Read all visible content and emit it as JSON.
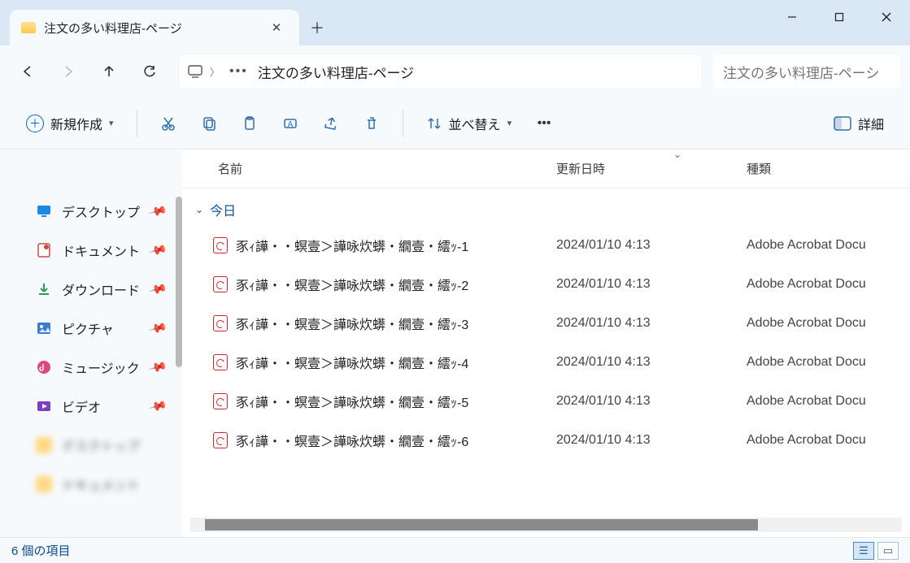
{
  "tab": {
    "title": "注文の多い料理店-ページ"
  },
  "address": {
    "segment": "注文の多い料理店-ページ"
  },
  "search": {
    "placeholder": "注文の多い料理店-ペーシ"
  },
  "toolbar": {
    "new_label": "新規作成",
    "sort_label": "並べ替え",
    "details_label": "詳細"
  },
  "sidebar": {
    "items": [
      {
        "label": "デスクトップ",
        "icon": "desktop",
        "color": "#1e88e5"
      },
      {
        "label": "ドキュメント",
        "icon": "document",
        "color": "#d04848"
      },
      {
        "label": "ダウンロード",
        "icon": "download",
        "color": "#2e9e55"
      },
      {
        "label": "ピクチャ",
        "icon": "picture",
        "color": "#3a7bd5"
      },
      {
        "label": "ミュージック",
        "icon": "music",
        "color": "#e0457b"
      },
      {
        "label": "ビデオ",
        "icon": "video",
        "color": "#7b3fbf"
      }
    ]
  },
  "columns": {
    "name": "名前",
    "date": "更新日時",
    "type": "種類"
  },
  "group": {
    "label": "今日"
  },
  "files": [
    {
      "name": "豕ｨ譁・・螟壹＞譁咏炊蠎・繝壹・繧ｯ-1",
      "date": "2024/01/10 4:13",
      "type": "Adobe Acrobat Docu"
    },
    {
      "name": "豕ｨ譁・・螟壹＞譁咏炊蠎・繝壹・繧ｯ-2",
      "date": "2024/01/10 4:13",
      "type": "Adobe Acrobat Docu"
    },
    {
      "name": "豕ｨ譁・・螟壹＞譁咏炊蠎・繝壹・繧ｯ-3",
      "date": "2024/01/10 4:13",
      "type": "Adobe Acrobat Docu"
    },
    {
      "name": "豕ｨ譁・・螟壹＞譁咏炊蠎・繝壹・繧ｯ-4",
      "date": "2024/01/10 4:13",
      "type": "Adobe Acrobat Docu"
    },
    {
      "name": "豕ｨ譁・・螟壹＞譁咏炊蠎・繝壹・繧ｯ-5",
      "date": "2024/01/10 4:13",
      "type": "Adobe Acrobat Docu"
    },
    {
      "name": "豕ｨ譁・・螟壹＞譁咏炊蠎・繝壹・繧ｯ-6",
      "date": "2024/01/10 4:13",
      "type": "Adobe Acrobat Docu"
    }
  ],
  "status": {
    "text": "6 個の項目"
  }
}
